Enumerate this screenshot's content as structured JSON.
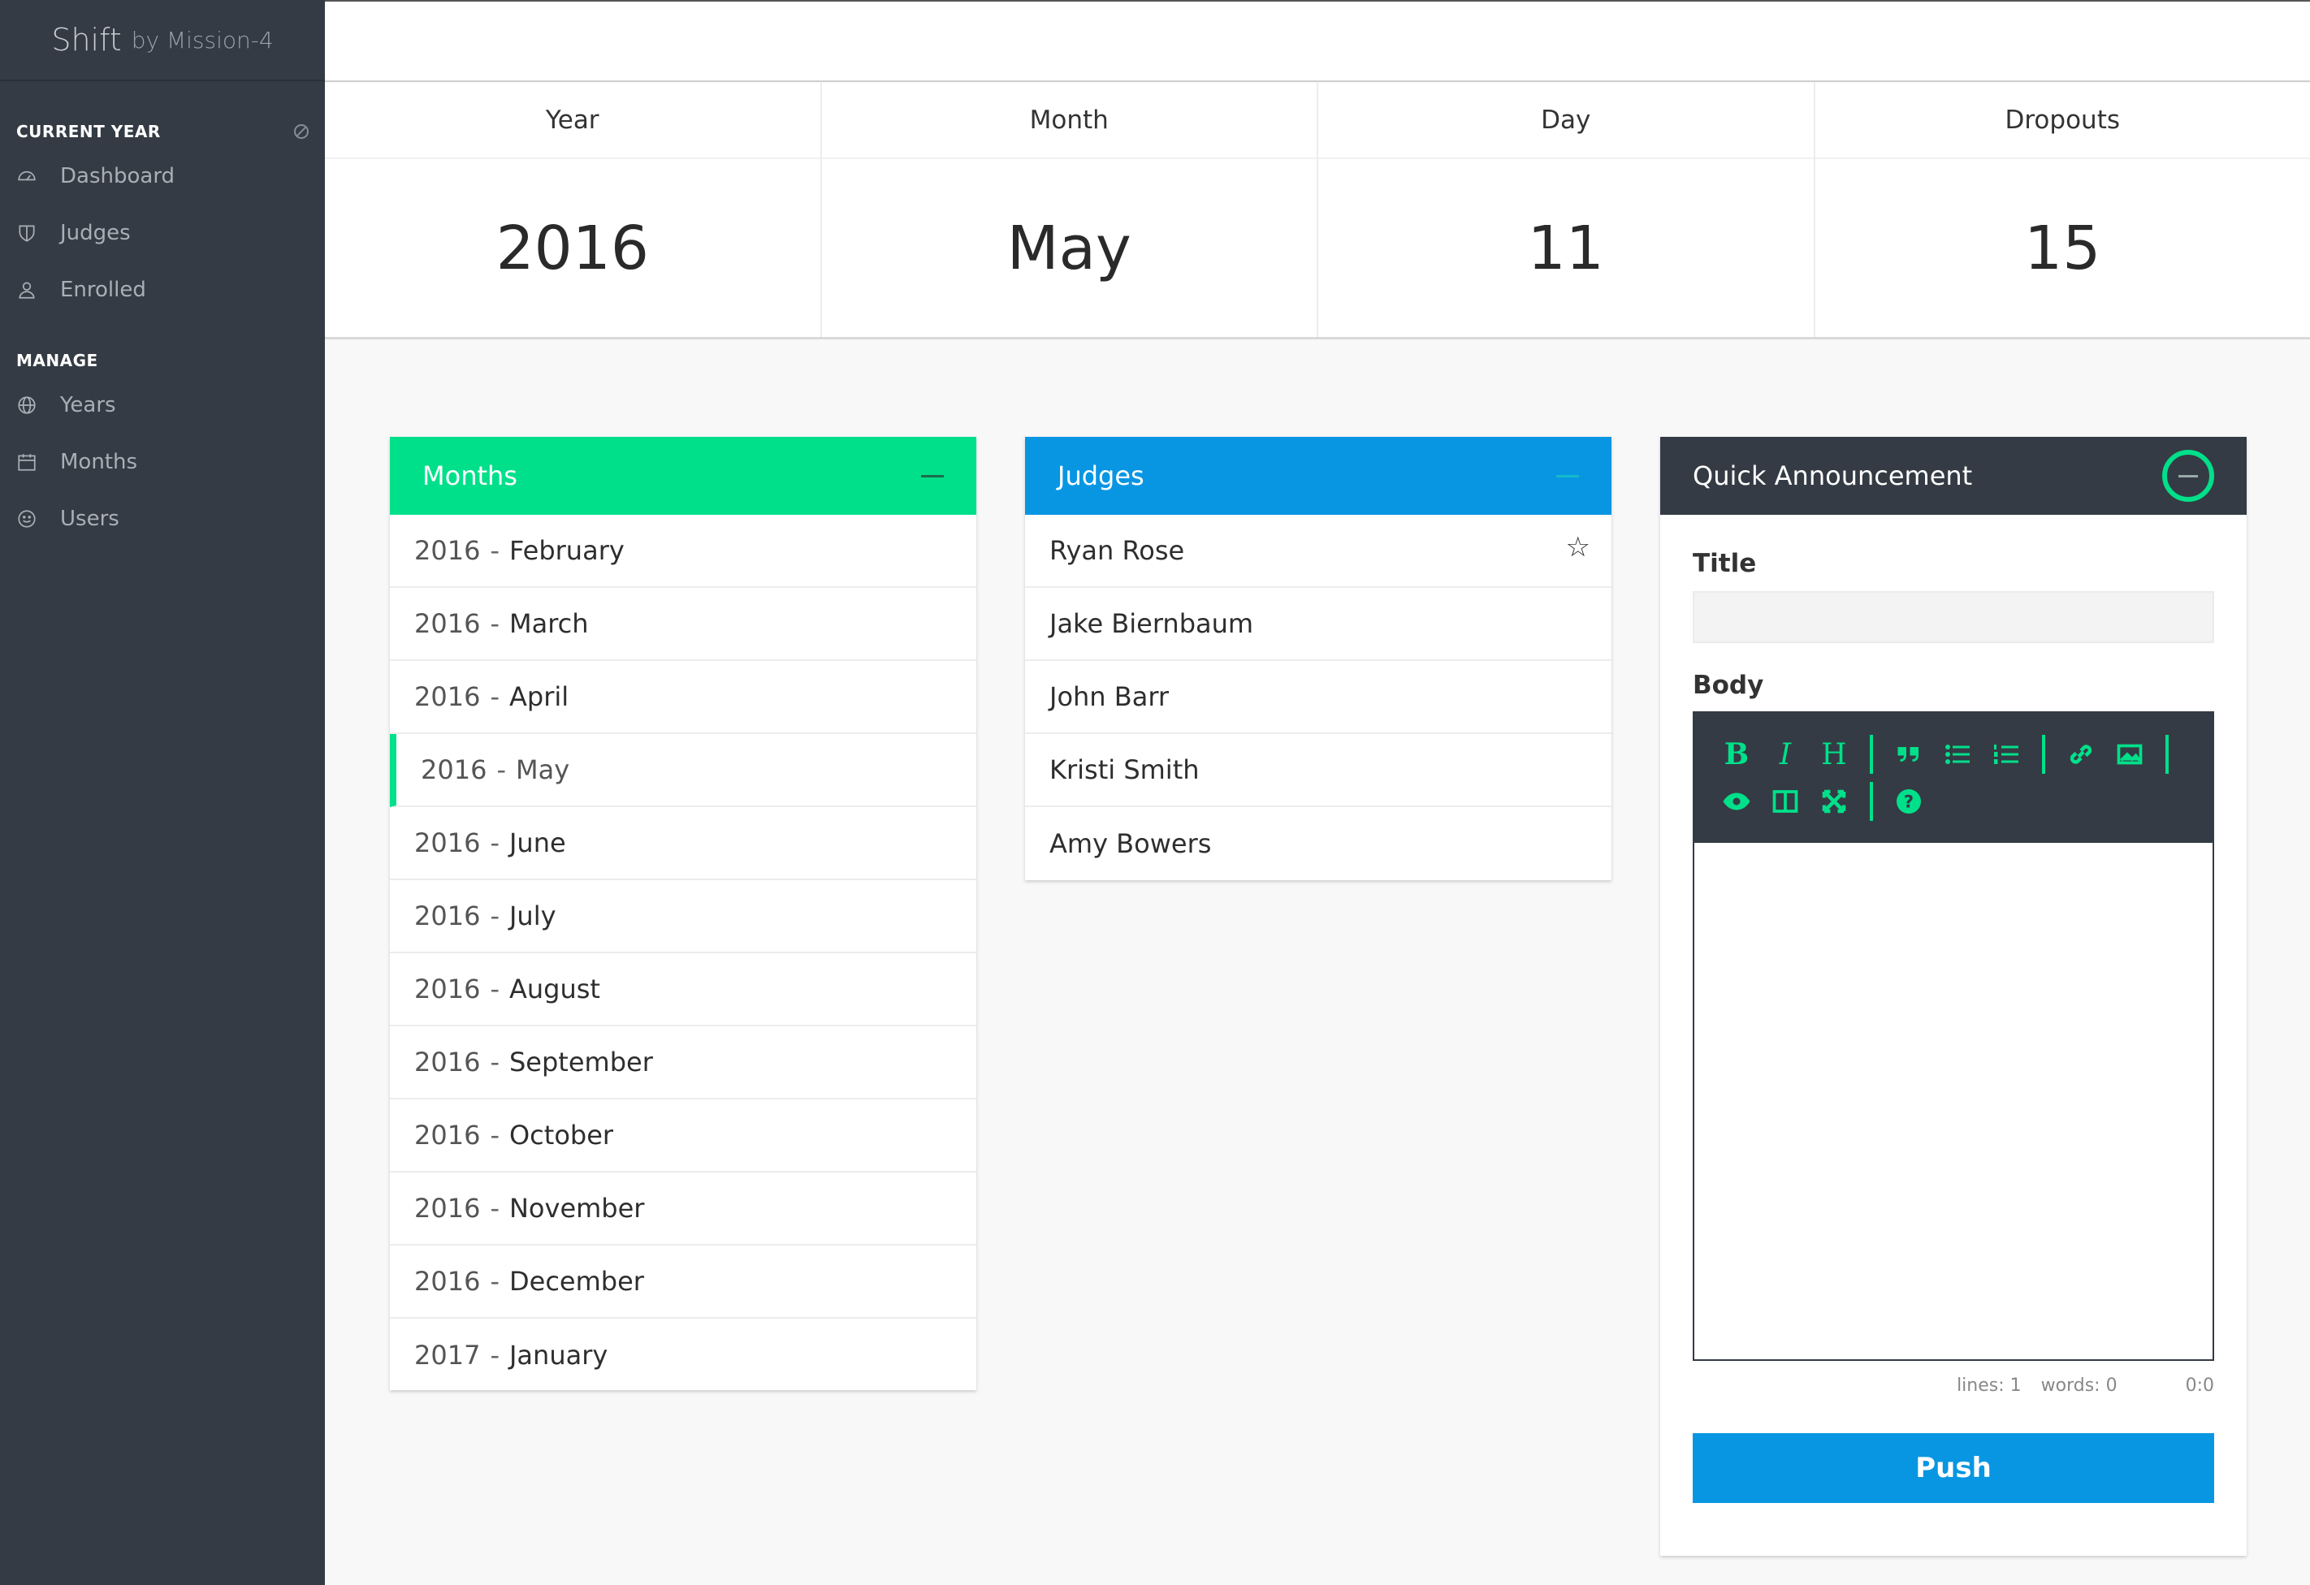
{
  "brand": {
    "name": "Shift",
    "suffix": "by Mission-4"
  },
  "sidebar": {
    "current_year_label": "CURRENT YEAR",
    "current_items": [
      {
        "label": "Dashboard",
        "icon": "dashboard-icon"
      },
      {
        "label": "Judges",
        "icon": "shield-icon"
      },
      {
        "label": "Enrolled",
        "icon": "user-icon"
      }
    ],
    "manage_label": "MANAGE",
    "manage_items": [
      {
        "label": "Years",
        "icon": "globe-icon"
      },
      {
        "label": "Months",
        "icon": "calendar-icon"
      },
      {
        "label": "Users",
        "icon": "smiley-icon"
      }
    ]
  },
  "stats": [
    {
      "label": "Year",
      "value": "2016"
    },
    {
      "label": "Month",
      "value": "May"
    },
    {
      "label": "Day",
      "value": "11"
    },
    {
      "label": "Dropouts",
      "value": "15"
    }
  ],
  "months_panel": {
    "title": "Months",
    "items": [
      {
        "year": "2016",
        "sep": "-",
        "month": "February"
      },
      {
        "year": "2016",
        "sep": "-",
        "month": "March"
      },
      {
        "year": "2016",
        "sep": "-",
        "month": "April"
      },
      {
        "year": "2016",
        "sep": "-",
        "month": "May"
      },
      {
        "year": "2016",
        "sep": "-",
        "month": "June"
      },
      {
        "year": "2016",
        "sep": "-",
        "month": "July"
      },
      {
        "year": "2016",
        "sep": "-",
        "month": "August"
      },
      {
        "year": "2016",
        "sep": "-",
        "month": "September"
      },
      {
        "year": "2016",
        "sep": "-",
        "month": "October"
      },
      {
        "year": "2016",
        "sep": "-",
        "month": "November"
      },
      {
        "year": "2016",
        "sep": "-",
        "month": "December"
      },
      {
        "year": "2017",
        "sep": "-",
        "month": "January"
      }
    ]
  },
  "judges_panel": {
    "title": "Judges",
    "items": [
      "Ryan Rose",
      "Jake Biernbaum",
      "John Barr",
      "Kristi Smith",
      "Amy Bowers"
    ],
    "star": "☆"
  },
  "announcement": {
    "title": "Quick Announcement",
    "title_label": "Title",
    "body_label": "Body",
    "title_value": "",
    "toolbar": {
      "bold": "B",
      "italic": "I",
      "heading": "H"
    },
    "status_lines": "lines: 1",
    "status_words": "words: 0",
    "status_pos": "0:0",
    "push_label": "Push"
  },
  "colors": {
    "accent_green": "#00e08a",
    "accent_blue": "#0896e3",
    "sidebar": "#343b44"
  }
}
